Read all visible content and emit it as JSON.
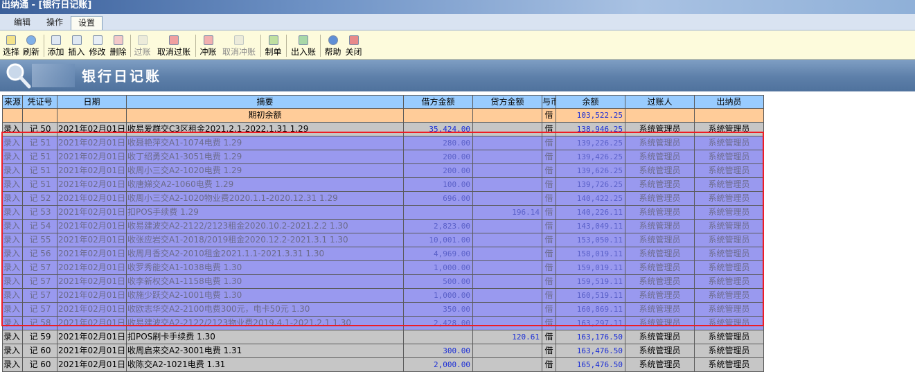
{
  "window": {
    "title": "出纳通 - [银行日记账]"
  },
  "menu": {
    "tabs": [
      "编辑",
      "操作",
      "设置"
    ]
  },
  "toolbar": {
    "select": "选择",
    "refresh": "刷新",
    "add": "添加",
    "insert": "插入",
    "modify": "修改",
    "delete": "删除",
    "post": "过账",
    "unpost": "取消过账",
    "offset": "冲账",
    "unoffset": "取消冲账",
    "make": "制单",
    "inout": "出入账",
    "help": "帮助",
    "close": "关闭"
  },
  "banner": {
    "title": "银行日记账"
  },
  "table": {
    "headers": [
      "来源",
      "凭证号",
      "日期",
      "摘要",
      "借方金额",
      "贷方金额",
      "与币",
      "余额",
      "过账人",
      "出纳员"
    ],
    "opening": {
      "summary": "期初余额",
      "dir": "借",
      "balance": "103,522.25"
    },
    "rows": [
      {
        "src": "录入",
        "vno": "记 50",
        "date": "2021年02月01日",
        "summary": "收易爱群交C3区租金2021.2.1-2022.1.31  1.29",
        "debit": "35,424.00",
        "credit": "",
        "dir": "借",
        "balance": "138,946.25",
        "poster": "系统管理员",
        "cashier": "系统管理员"
      },
      {
        "src": "录入",
        "vno": "记 51",
        "date": "2021年02月01日",
        "summary": "收聂艳萍交A1-1074电费    1.29",
        "debit": "280.00",
        "credit": "",
        "dir": "借",
        "balance": "139,226.25",
        "poster": "系统管理员",
        "cashier": "系统管理员"
      },
      {
        "src": "录入",
        "vno": "记 51",
        "date": "2021年02月01日",
        "summary": "收丁绍勇交A1-3051电费    1.29",
        "debit": "200.00",
        "credit": "",
        "dir": "借",
        "balance": "139,426.25",
        "poster": "系统管理员",
        "cashier": "系统管理员"
      },
      {
        "src": "录入",
        "vno": "记 51",
        "date": "2021年02月01日",
        "summary": "收周小三交A2-1020电费    1.29",
        "debit": "200.00",
        "credit": "",
        "dir": "借",
        "balance": "139,626.25",
        "poster": "系统管理员",
        "cashier": "系统管理员"
      },
      {
        "src": "录入",
        "vno": "记 51",
        "date": "2021年02月01日",
        "summary": "收唐娣交A2-1060电费    1.29",
        "debit": "100.00",
        "credit": "",
        "dir": "借",
        "balance": "139,726.25",
        "poster": "系统管理员",
        "cashier": "系统管理员"
      },
      {
        "src": "录入",
        "vno": "记 52",
        "date": "2021年02月01日",
        "summary": "收周小三交A2-1020物业费2020.1.1-2020.12.31  1.29",
        "debit": "696.00",
        "credit": "",
        "dir": "借",
        "balance": "140,422.25",
        "poster": "系统管理员",
        "cashier": "系统管理员"
      },
      {
        "src": "录入",
        "vno": "记 53",
        "date": "2021年02月01日",
        "summary": "扣POS手续费      1.29",
        "debit": "",
        "credit": "196.14",
        "dir": "借",
        "balance": "140,226.11",
        "poster": "系统管理员",
        "cashier": "系统管理员"
      },
      {
        "src": "录入",
        "vno": "记 54",
        "date": "2021年02月01日",
        "summary": "收易建波交A2-2122/2123租金2020.10.2-2021.2.2  1.30",
        "debit": "2,823.00",
        "credit": "",
        "dir": "借",
        "balance": "143,049.11",
        "poster": "系统管理员",
        "cashier": "系统管理员"
      },
      {
        "src": "录入",
        "vno": "记 55",
        "date": "2021年02月01日",
        "summary": "收张应岩交A1-2018/2019租金2020.12.2-2021.3.1    1.30",
        "debit": "10,001.00",
        "credit": "",
        "dir": "借",
        "balance": "153,050.11",
        "poster": "系统管理员",
        "cashier": "系统管理员"
      },
      {
        "src": "录入",
        "vno": "记 56",
        "date": "2021年02月01日",
        "summary": "收周月香交A2-2010租金2021.1.1-2021.3.31     1.30",
        "debit": "4,969.00",
        "credit": "",
        "dir": "借",
        "balance": "158,019.11",
        "poster": "系统管理员",
        "cashier": "系统管理员"
      },
      {
        "src": "录入",
        "vno": "记 57",
        "date": "2021年02月01日",
        "summary": "收罗秀能交A1-1038电费      1.30",
        "debit": "1,000.00",
        "credit": "",
        "dir": "借",
        "balance": "159,019.11",
        "poster": "系统管理员",
        "cashier": "系统管理员"
      },
      {
        "src": "录入",
        "vno": "记 57",
        "date": "2021年02月01日",
        "summary": "收李新权交A1-1158电费     1.30",
        "debit": "500.00",
        "credit": "",
        "dir": "借",
        "balance": "159,519.11",
        "poster": "系统管理员",
        "cashier": "系统管理员"
      },
      {
        "src": "录入",
        "vno": "记 57",
        "date": "2021年02月01日",
        "summary": "收施少跃交A2-1001电费     1.30",
        "debit": "1,000.00",
        "credit": "",
        "dir": "借",
        "balance": "160,519.11",
        "poster": "系统管理员",
        "cashier": "系统管理员"
      },
      {
        "src": "录入",
        "vno": "记 57",
        "date": "2021年02月01日",
        "summary": "收欧志华交A2-2100电费300元，电卡50元     1.30",
        "debit": "350.00",
        "credit": "",
        "dir": "借",
        "balance": "160,869.11",
        "poster": "系统管理员",
        "cashier": "系统管理员"
      },
      {
        "src": "录入",
        "vno": "记 58",
        "date": "2021年02月01日",
        "summary": "收易建波交A2-2122/2123物业费2019.4.1-2021.2.1    1.30",
        "debit": "2,428.00",
        "credit": "",
        "dir": "借",
        "balance": "163,297.11",
        "poster": "系统管理员",
        "cashier": "系统管理员"
      },
      {
        "src": "录入",
        "vno": "记 59",
        "date": "2021年02月01日",
        "summary": "扣POS刷卡手续费     1.30",
        "debit": "",
        "credit": "120.61",
        "dir": "借",
        "balance": "163,176.50",
        "poster": "系统管理员",
        "cashier": "系统管理员"
      },
      {
        "src": "录入",
        "vno": "记 60",
        "date": "2021年02月01日",
        "summary": "收周启来交A2-3001电费    1.31",
        "debit": "300.00",
        "credit": "",
        "dir": "借",
        "balance": "163,476.50",
        "poster": "系统管理员",
        "cashier": "系统管理员"
      },
      {
        "src": "录入",
        "vno": "记 60",
        "date": "2021年02月01日",
        "summary": "收陈交A2-1021电费    1.31",
        "debit": "2,000.00",
        "credit": "",
        "dir": "借",
        "balance": "165,476.50",
        "poster": "系统管理员",
        "cashier": "系统管理员"
      }
    ]
  },
  "colors": {
    "header_bg": "#99ccff",
    "opening_bg": "#ffcc99",
    "selected_bg": "#9999ef",
    "row_bg": "#c6c6c6",
    "highlight": "#ee1c25"
  }
}
